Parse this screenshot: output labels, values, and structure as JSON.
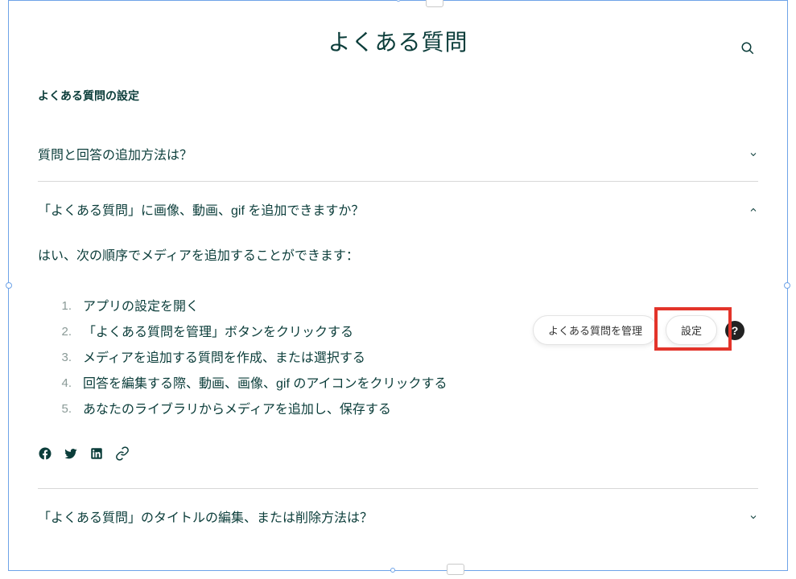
{
  "page": {
    "title": "よくある質問",
    "section_label": "よくある質問の設定"
  },
  "faq": [
    {
      "question": "質問と回答の追加方法は？",
      "expanded": false
    },
    {
      "question": "「よくある質問」に画像、動画、gif を追加できますか？",
      "expanded": true,
      "answer_intro": "はい、次の順序でメディアを追加することができます：",
      "steps": [
        "アプリの設定を開く",
        "「よくある質問を管理」ボタンをクリックする",
        "メディアを追加する質問を作成、または選択する",
        "回答を編集する際、動画、画像、gif のアイコンをクリックする",
        "あなたのライブラリからメディアを追加し、保存する"
      ]
    },
    {
      "question": "「よくある質問」のタイトルの編集、または削除方法は？",
      "expanded": false
    }
  ],
  "controls": {
    "manage_label": "よくある質問を管理",
    "settings_label": "設定",
    "help_symbol": "?"
  },
  "step_numbers": [
    "1.",
    "2.",
    "3.",
    "4.",
    "5."
  ],
  "icons": {
    "search": "search-icon",
    "facebook": "facebook-icon",
    "twitter": "twitter-icon",
    "linkedin": "linkedin-icon",
    "link": "link-icon"
  }
}
